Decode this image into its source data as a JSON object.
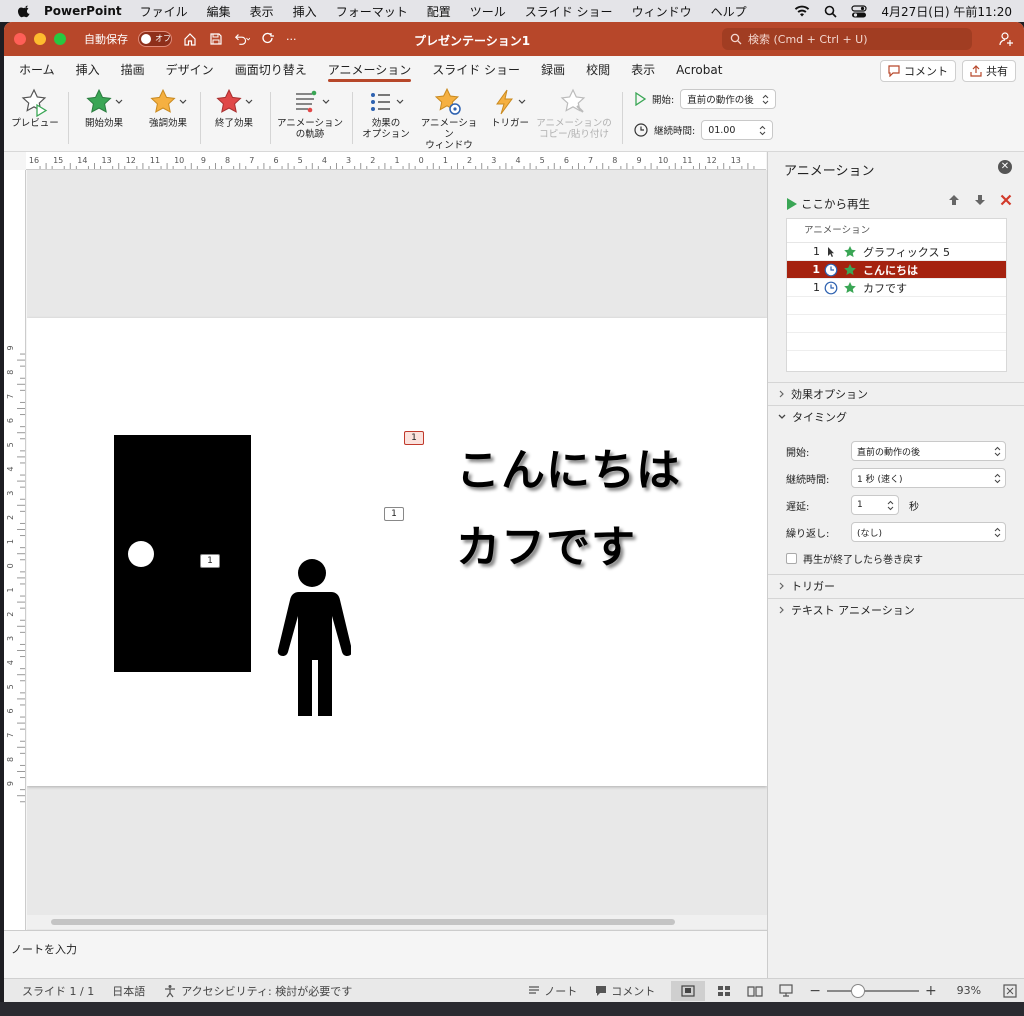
{
  "menubar": {
    "app_name": "PowerPoint",
    "items": [
      "ファイル",
      "編集",
      "表示",
      "挿入",
      "フォーマット",
      "配置",
      "ツール",
      "スライド ショー",
      "ウィンドウ",
      "ヘルプ"
    ],
    "datetime": "4月27日(日) 午前11:20"
  },
  "titlebar": {
    "autosave_label": "自動保存",
    "autosave_state": "オフ",
    "more": "···",
    "doc_title": "プレゼンテーション1",
    "search_placeholder": "検索 (Cmd + Ctrl + U)"
  },
  "tabs": {
    "items": [
      "ホーム",
      "挿入",
      "描画",
      "デザイン",
      "画面切り替え",
      "アニメーション",
      "スライド ショー",
      "録画",
      "校閲",
      "表示",
      "Acrobat"
    ],
    "active": "アニメーション",
    "comment_label": "コメント",
    "share_label": "共有"
  },
  "ribbon": {
    "preview": "プレビュー",
    "entrance": "開始効果",
    "emphasis": "強調効果",
    "exit": "終了効果",
    "path_1": "アニメーション",
    "path_2": "の軌跡",
    "options_1": "効果の",
    "options_2": "オプション",
    "pane_1": "アニメーション",
    "pane_2": "ウィンドウ",
    "trigger": "トリガー",
    "copy_1": "アニメーションの",
    "copy_2": "コピー/貼り付け",
    "start_label": "開始:",
    "start_value": "直前の動作の後",
    "duration_label": "継続時間:",
    "duration_value": "01.00"
  },
  "ruler": {
    "h_ticks": [
      "16",
      "15",
      "14",
      "13",
      "12",
      "11",
      "10",
      "9",
      "8",
      "7",
      "6",
      "5",
      "4",
      "3",
      "2",
      "1",
      "0",
      "1",
      "2",
      "3",
      "4",
      "5",
      "6",
      "7",
      "8",
      "9",
      "10",
      "11",
      "12",
      "13"
    ],
    "v_ticks": [
      "9",
      "8",
      "7",
      "6",
      "5",
      "4",
      "3",
      "2",
      "1",
      "0",
      "1",
      "2",
      "3",
      "4",
      "5",
      "6",
      "7",
      "8",
      "9"
    ]
  },
  "slide": {
    "text_1": "こんにちは",
    "text_2": "カフです",
    "badge_door": "1",
    "badge_text1": "1",
    "badge_text2": "1"
  },
  "notes_placeholder": "ノートを入力",
  "status": {
    "slide": "スライド 1 / 1",
    "language": "日本語",
    "accessibility": "アクセシビリティ: 検討が必要です",
    "notes": "ノート",
    "comments": "コメント",
    "zoom": "93%",
    "zoom_fraction": 0.31
  },
  "pane": {
    "title": "アニメーション",
    "play_from": "ここから再生",
    "list_header": "アニメーション",
    "items": [
      {
        "num": "1",
        "name": "グラフィックス 5"
      },
      {
        "num": "1",
        "name": "こんにちは"
      },
      {
        "num": "1",
        "name": "カフです"
      }
    ],
    "effect_options": "効果オプション",
    "timing": "タイミング",
    "start_label": "開始:",
    "start_value": "直前の動作の後",
    "duration_label": "継続時間:",
    "duration_value": "1 秒 (速く)",
    "delay_label": "遅延:",
    "delay_value": "1",
    "delay_unit": "秒",
    "repeat_label": "繰り返し:",
    "repeat_value": "(なし)",
    "rewind_label": "再生が終了したら巻き戻す",
    "trigger": "トリガー",
    "text_animation": "テキスト アニメーション"
  },
  "colors": {
    "accent": "#b7472a",
    "selected_row": "#a5220f",
    "star_green": "#3aa655",
    "star_orange": "#f5b041",
    "star_red": "#e04848"
  }
}
